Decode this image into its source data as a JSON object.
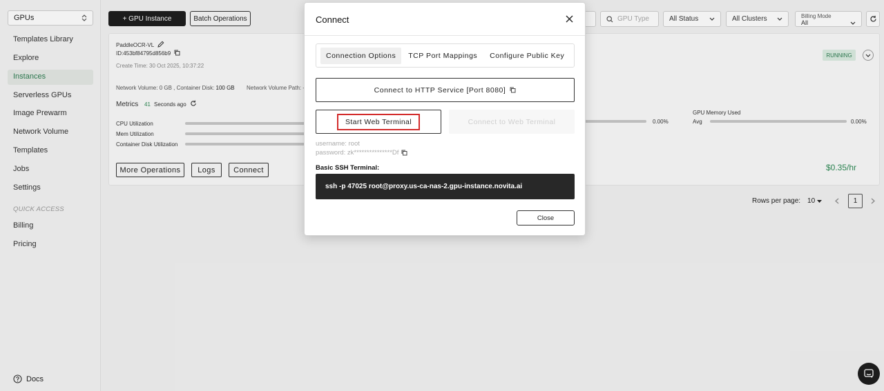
{
  "sidebar": {
    "selector": "GPUs",
    "items": [
      {
        "label": "Templates Library",
        "active": false
      },
      {
        "label": "Explore",
        "active": false
      },
      {
        "label": "Instances",
        "active": true
      },
      {
        "label": "Serverless GPUs",
        "active": false
      },
      {
        "label": "Image Prewarm",
        "active": false
      },
      {
        "label": "Network Volume",
        "active": false
      },
      {
        "label": "Templates",
        "active": false
      },
      {
        "label": "Jobs",
        "active": false
      },
      {
        "label": "Settings",
        "active": false
      }
    ],
    "quick_access_label": "QUICK ACCESS",
    "quick_items": [
      {
        "label": "Billing"
      },
      {
        "label": "Pricing"
      }
    ],
    "docs_label": "Docs"
  },
  "toolbar": {
    "add_instance_label": "+ GPU Instance",
    "batch_label": "Batch Operations",
    "gpu_type_placeholder": "GPU Type",
    "status_filter": "All Status",
    "cluster_filter": "All Clusters",
    "billing_mode_label": "Billing Mode",
    "billing_mode_value": "All"
  },
  "instance": {
    "name": "PaddleOCR-VL",
    "id": "ID:453bf84795d856b9",
    "create_time": "Create Time: 30 Oct 2025, 10:37:22",
    "network_volume_prefix": "Network Volume: ",
    "network_volume_value": "0 GB",
    "container_disk_prefix": " , Container Disk: ",
    "container_disk_value": "100 GB",
    "network_volume_path": "Network Volume Path: -",
    "metrics_label": "Metrics",
    "metrics_count": "41",
    "metrics_ago": "Seconds ago",
    "cpu_label": "CPU Utilization",
    "mem_label": "Mem Utilization",
    "disk_label": "Container Disk Utilization",
    "util_value": "0.00%",
    "gpu_mem_label": "GPU Memory Used",
    "gpu_mem_avg": "Avg",
    "gpu_mem_value": "0.00%",
    "status": "RUNNING",
    "more_ops_label": "More Operations",
    "logs_label": "Logs",
    "connect_label": "Connect",
    "price": "$0.35/hr"
  },
  "pagination": {
    "rows_label": "Rows per page:",
    "rows_value": "10",
    "page": "1"
  },
  "modal": {
    "title": "Connect",
    "tabs": [
      "Connection Options",
      "TCP Port Mappings",
      "Configure Public Key"
    ],
    "active_tab": 0,
    "http_button": "Connect to HTTP Service [Port 8080]",
    "start_web_terminal": "Start Web Terminal",
    "connect_web_terminal": "Connect to Web Terminal",
    "username": "username: root",
    "password": "password: zk***************Df",
    "ssh_label": "Basic SSH Terminal:",
    "ssh_command": "ssh -p 47025 root@proxy.us-ca-nas-2.gpu-instance.novita.ai",
    "close_label": "Close"
  },
  "colors": {
    "accent_green": "#2e7d52",
    "highlight_red": "#d32b2b",
    "dark": "#1e1e1e"
  }
}
